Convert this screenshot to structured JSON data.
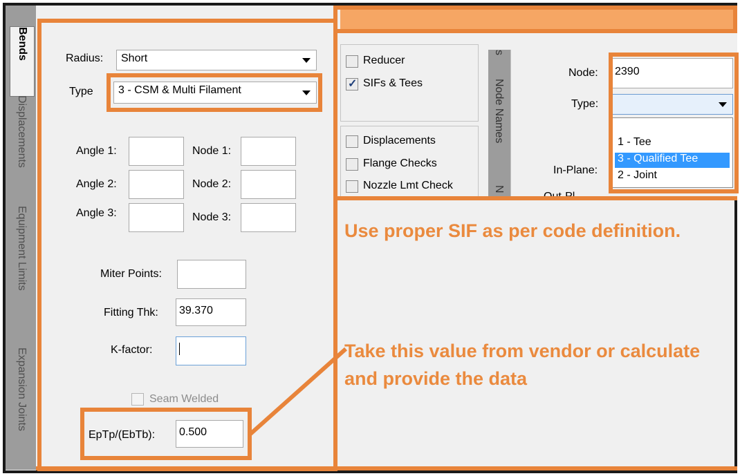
{
  "tabs": [
    {
      "label": "Bends",
      "active": true
    },
    {
      "label": "Displacements",
      "active": false
    },
    {
      "label": "Equipment Limits",
      "active": false
    },
    {
      "label": "Expansion Joints",
      "active": false
    }
  ],
  "bends": {
    "radius_label": "Radius:",
    "radius_value": "Short",
    "type_label": "Type",
    "type_value": "3 - CSM & Multi Filament",
    "angle1_label": "Angle 1:",
    "angle2_label": "Angle 2:",
    "angle3_label": "Angle 3:",
    "node1_label": "Node 1:",
    "node2_label": "Node 2:",
    "node3_label": "Node 3:",
    "miter_label": "Miter Points:",
    "fitting_label": "Fitting Thk:",
    "fitting_value": "39.370",
    "kfactor_label": "K-factor:",
    "kfactor_value": "",
    "seam_label": "Seam Welded",
    "ep_label": "EpTp/(EbTb):",
    "ep_value": "0.500"
  },
  "checks_group1": [
    {
      "label": "Reducer",
      "checked": false
    },
    {
      "label": "SIFs & Tees",
      "checked": true
    }
  ],
  "checks_group2": [
    {
      "label": "Displacements",
      "checked": false
    },
    {
      "label": "Flange Checks",
      "checked": false
    },
    {
      "label": "Nozzle Lmt Check",
      "checked": false
    }
  ],
  "sif": {
    "vtab_s": "s",
    "vtab_node_names": "Node Names",
    "vtab_n": "N",
    "node_label": "Node:",
    "node_value": "2390",
    "type_label": "Type:",
    "inplane_label": "In-Plane:",
    "outplane_label": "Out-Pl",
    "options": [
      {
        "label": "1 - Tee",
        "selected": false
      },
      {
        "label": "3 - Qualified Tee",
        "selected": true
      },
      {
        "label": "2 - Joint",
        "selected": false
      }
    ]
  },
  "notes": {
    "note1": "Use proper SIF as per code definition.",
    "note2": "Take this value from vendor or calculate and provide the data"
  },
  "colors": {
    "highlight": "#e8843a",
    "note_text": "#ea8a3e",
    "selected_option": "#3399ff"
  }
}
